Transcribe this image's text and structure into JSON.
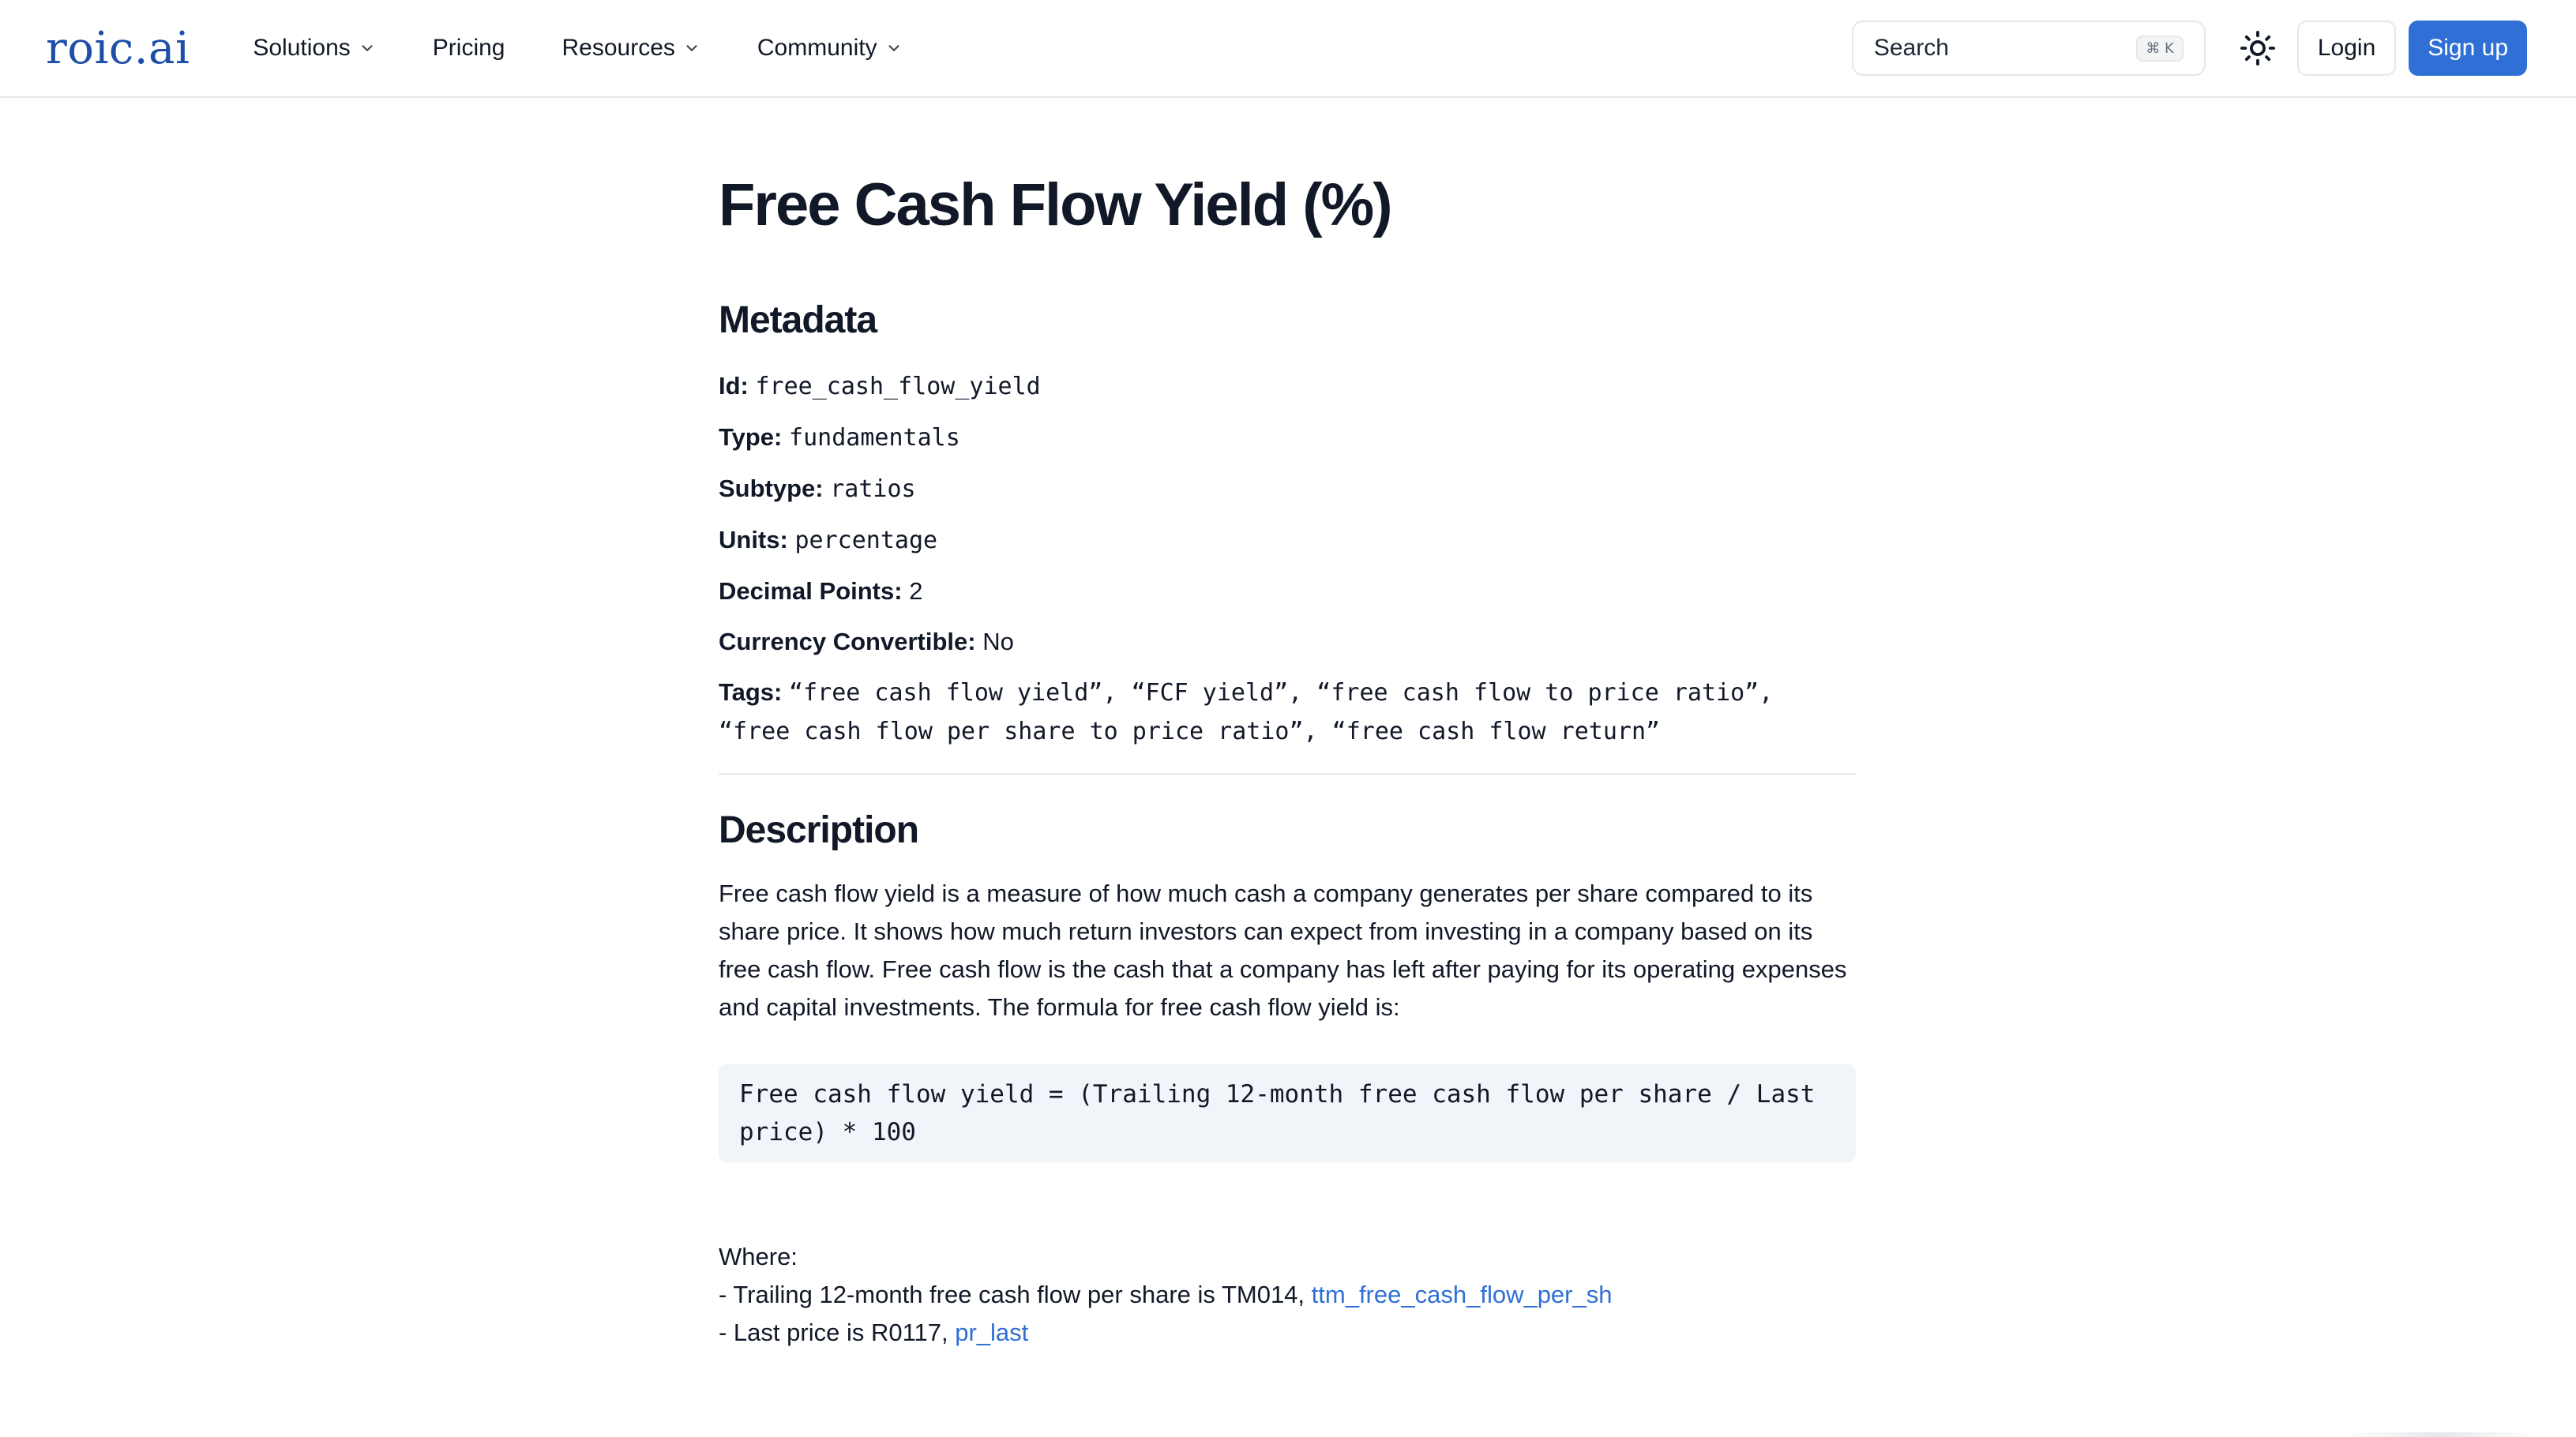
{
  "header": {
    "logo": "roic.ai",
    "nav": [
      {
        "label": "Solutions",
        "has_dropdown": true
      },
      {
        "label": "Pricing",
        "has_dropdown": false
      },
      {
        "label": "Resources",
        "has_dropdown": true
      },
      {
        "label": "Community",
        "has_dropdown": true
      }
    ],
    "search": {
      "label": "Search",
      "shortcut": "⌘ K"
    },
    "theme_icon": "sun-icon",
    "login_label": "Login",
    "signup_label": "Sign up",
    "accent_color": "#2f6fd6",
    "logo_color": "#1e4fa8"
  },
  "main": {
    "title": "Free Cash Flow Yield (%)",
    "metadata_heading": "Metadata",
    "metadata": {
      "id_label": "Id:",
      "id_value": "free_cash_flow_yield",
      "type_label": "Type:",
      "type_value": "fundamentals",
      "subtype_label": "Subtype:",
      "subtype_value": "ratios",
      "units_label": "Units:",
      "units_value": "percentage",
      "decimal_label": "Decimal Points:",
      "decimal_value": "2",
      "currency_label": "Currency Convertible:",
      "currency_value": "No",
      "tags_label": "Tags:",
      "tags_value": "“free cash flow yield”, “FCF yield”, “free cash flow to price ratio”, “free cash flow per share to price ratio”, “free cash flow return”"
    },
    "description_heading": "Description",
    "description": "Free cash flow yield is a measure of how much cash a company generates per share compared to its share price. It shows how much return investors can expect from investing in a company based on its free cash flow. Free cash flow is the cash that a company has left after paying for its operating expenses and capital investments. The formula for free cash flow yield is:",
    "formula": "Free cash flow yield = (Trailing 12-month free cash flow per share / Last price) * 100",
    "where_label": "Where:",
    "where_items": [
      {
        "text": "- Trailing 12-month free cash flow per share is TM014, ",
        "link": "ttm_free_cash_flow_per_sh"
      },
      {
        "text": "- Last price is R0117, ",
        "link": "pr_last"
      }
    ]
  }
}
